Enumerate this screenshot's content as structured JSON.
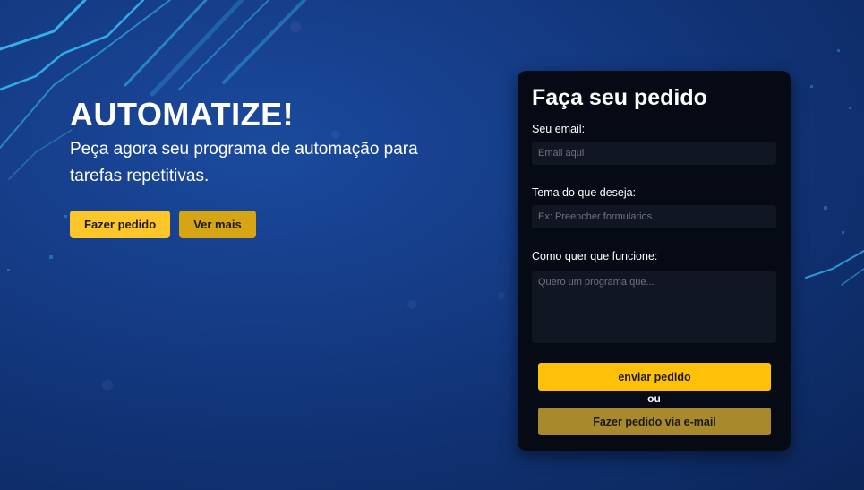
{
  "hero": {
    "title": "AUTOMATIZE!",
    "subtitle": "Peça agora seu programa de automação para tarefas repetitivas.",
    "primary_button": "Fazer pedido",
    "secondary_button": "Ver mais"
  },
  "order_form": {
    "title": "Faça seu pedido",
    "email_label": "Seu email:",
    "email_placeholder": "Email aqui",
    "email_value": "",
    "topic_label": "Tema do que deseja:",
    "topic_placeholder": "Ex: Preencher formularios",
    "topic_value": "",
    "details_label": "Como quer que funcione:",
    "details_placeholder": "Quero um programa que...",
    "details_value": "",
    "submit_button": "enviar pedido",
    "or_text": "ou",
    "email_order_button": "Fazer pedido via e-mail"
  },
  "colors": {
    "background": "#153c86",
    "card": "#050a14",
    "input": "#111722",
    "primary_yellow": "#ffc62a",
    "secondary_yellow": "#d6a514",
    "send_button": "#ffc107",
    "mail_button": "#a8892c",
    "circuit_line": "#39c6ff"
  }
}
